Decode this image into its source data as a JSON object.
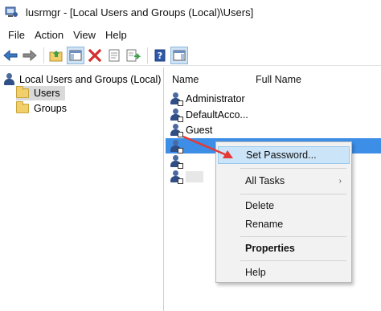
{
  "window": {
    "title": "lusrmgr - [Local Users and Groups (Local)\\Users]"
  },
  "menu": [
    "File",
    "Action",
    "View",
    "Help"
  ],
  "toolbar": {
    "buttons": [
      "back-arrow-icon",
      "forward-arrow-icon",
      "up-folder-icon",
      "show-hide-tree-icon",
      "delete-icon",
      "properties-icon",
      "export-list-icon",
      "help-icon",
      "show-hide-action-pane-icon"
    ]
  },
  "tree": {
    "root": "Local Users and Groups (Local)",
    "children": [
      "Users",
      "Groups"
    ],
    "selected": "Users"
  },
  "list": {
    "columns": [
      "Name",
      "Full Name"
    ],
    "users": [
      {
        "name": "Administrator"
      },
      {
        "name": "DefaultAcco..."
      },
      {
        "name": "Guest"
      },
      {
        "name": ""
      },
      {
        "name": ""
      },
      {
        "name": ""
      }
    ],
    "selected_index": 3
  },
  "context_menu": {
    "items": [
      {
        "label": "Set Password...",
        "highlighted": true
      },
      {
        "label": "All Tasks",
        "submenu": true
      },
      {
        "label": "Delete"
      },
      {
        "label": "Rename"
      },
      {
        "label": "Properties",
        "bold": true
      },
      {
        "label": "Help"
      }
    ]
  },
  "colors": {
    "selection": "#3d8ee6",
    "menu_hover": "#cce4f7",
    "annotation_arrow": "#e53935",
    "delete_red": "#d32f2f"
  }
}
